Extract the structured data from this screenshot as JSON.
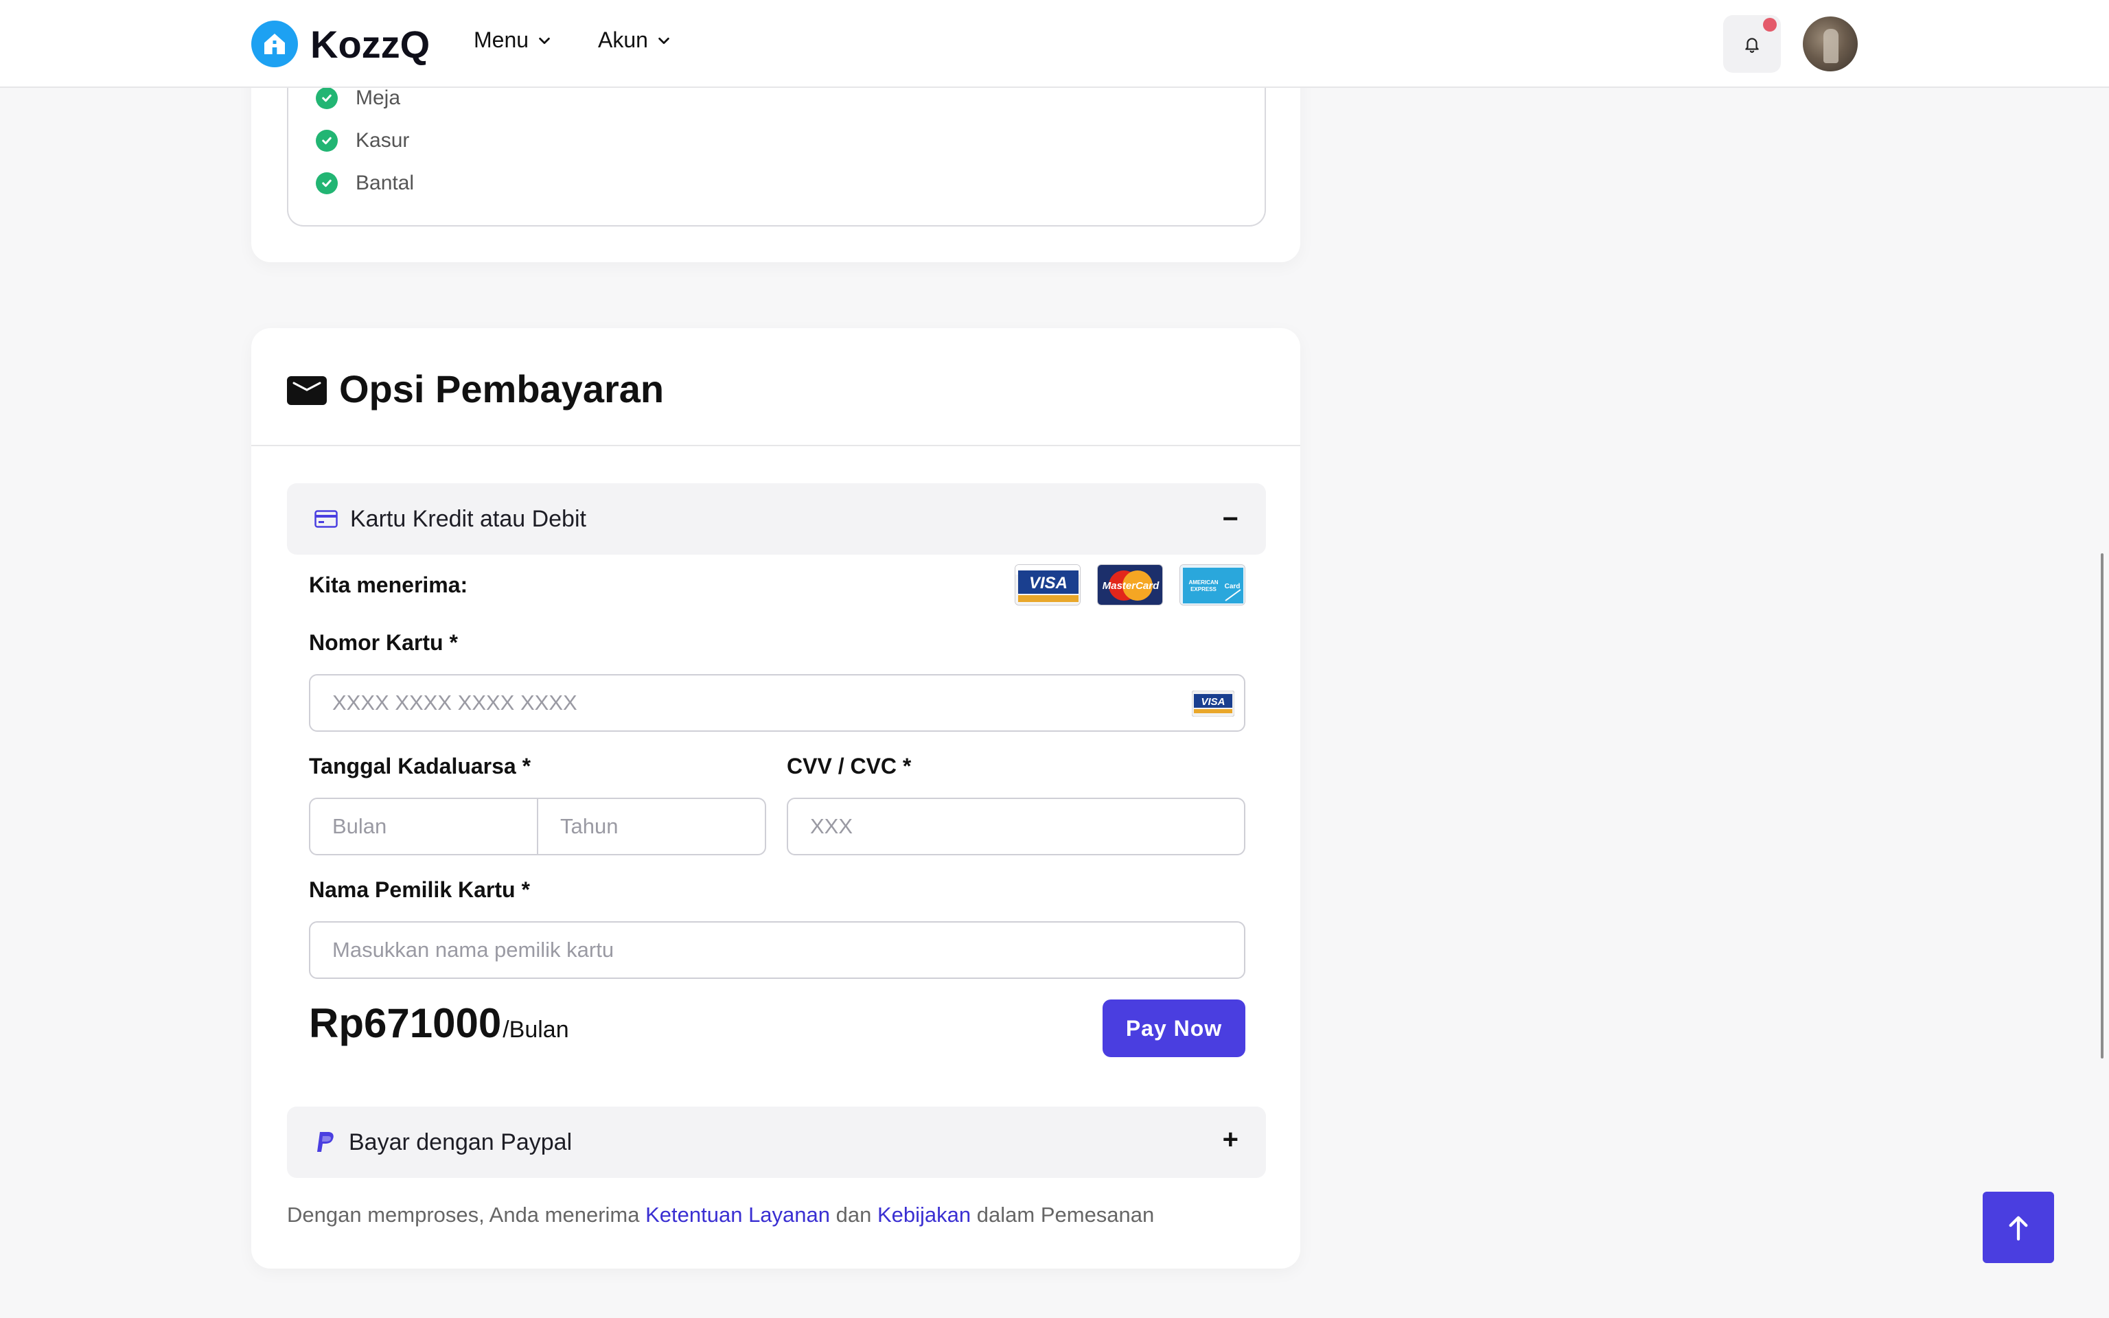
{
  "header": {
    "logo_text": "KozzQ",
    "nav": [
      {
        "label": "Menu"
      },
      {
        "label": "Akun"
      }
    ],
    "icons": {
      "notification": "bell-icon",
      "profile": "avatar"
    }
  },
  "facilities": {
    "items": [
      {
        "label": "Meja"
      },
      {
        "label": "Kasur"
      },
      {
        "label": "Bantal"
      }
    ]
  },
  "payment": {
    "title": "Opsi Pembayaran",
    "card_section": {
      "label": "Kartu Kredit atau Debit",
      "toggle": "−",
      "accept_label": "Kita menerima:",
      "logos": [
        "VISA",
        "MasterCard",
        "American Express Card"
      ],
      "card_number": {
        "label": "Nomor Kartu *",
        "placeholder": "XXXX XXXX XXXX XXXX"
      },
      "expiry": {
        "label": "Tanggal Kadaluarsa *",
        "month_placeholder": "Bulan",
        "year_placeholder": "Tahun"
      },
      "cvv": {
        "label": "CVV / CVC *",
        "placeholder": "XXX"
      },
      "holder": {
        "label": "Nama Pemilik Kartu *",
        "placeholder": "Masukkan nama pemilik kartu"
      },
      "price_value": "Rp671000",
      "price_unit": "/Bulan",
      "pay_button": "Pay Now"
    },
    "paypal_section": {
      "label": "Bayar dengan Paypal",
      "toggle": "+"
    },
    "terms": {
      "prefix": "Dengan memproses, Anda menerima",
      "link1": "Ketentuan Layanan",
      "middle": "dan",
      "link2": "Kebijakan",
      "suffix": "dalam Pemesanan"
    }
  },
  "colors": {
    "accent": "#4a3ee0",
    "logo_blue": "#1da1f2",
    "check_green": "#22b573",
    "notification_dot": "#e45a6a"
  }
}
